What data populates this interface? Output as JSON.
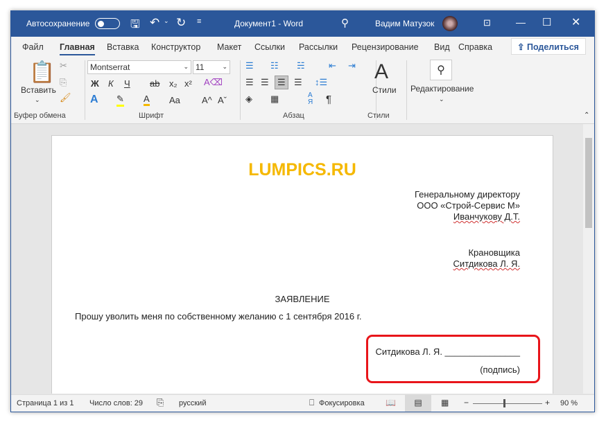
{
  "titlebar": {
    "autosave": "Автосохранение",
    "autosave_on": false,
    "doc_title": "Документ1  -  Word",
    "user": "Вадим Матузок",
    "icons": [
      "save-icon",
      "undo-icon",
      "redo-icon",
      "customize-icon",
      "search-icon",
      "ribbon-display-icon",
      "minimize-icon",
      "maximize-icon",
      "close-icon"
    ]
  },
  "tabs": [
    "Файл",
    "Главная",
    "Вставка",
    "Конструктор",
    "Макет",
    "Ссылки",
    "Рассылки",
    "Рецензирование",
    "Вид",
    "Справка"
  ],
  "active_tab": "Главная",
  "share": "Поделиться",
  "ribbon": {
    "clipboard": {
      "paste": "Вставить",
      "group": "Буфер обмена"
    },
    "font": {
      "name": "Montserrat",
      "size": "11",
      "group": "Шрифт",
      "buttons": [
        "Ж",
        "К",
        "Ч",
        "ab",
        "x₂",
        "x²",
        "A",
        "A",
        "Aa",
        "A^",
        "Aˇ"
      ]
    },
    "paragraph": {
      "group": "Абзац",
      "sort": "А Я",
      "pilcrow": "¶"
    },
    "styles": {
      "label": "Стили",
      "group": "Стили"
    },
    "editing": {
      "label": "Редактирование"
    }
  },
  "document": {
    "logo": "LUMPICS.RU",
    "addressee": [
      "Генеральному директору",
      "ООО «Строй-Сервис М»",
      "Иванчукову Д.Т."
    ],
    "sender": [
      "Крановщика",
      "Ситдикова Л. Я."
    ],
    "heading": "ЗАЯВЛЕНИЕ",
    "body": "Прошу уволить меня по собственному желанию с 1 сентября 2016 г.",
    "signature_line": "Ситдикова Л. Я. _______________",
    "signature_caption": "(подпись)"
  },
  "colors": {
    "brand": "#2b579a",
    "logo": "#f5b800",
    "highlight": "#e8151a"
  },
  "status": {
    "page": "Страница 1 из 1",
    "words": "Число слов: 29",
    "language": "русский",
    "focus": "Фокусировка",
    "zoom": "90 %",
    "zoom_percent": 90
  }
}
